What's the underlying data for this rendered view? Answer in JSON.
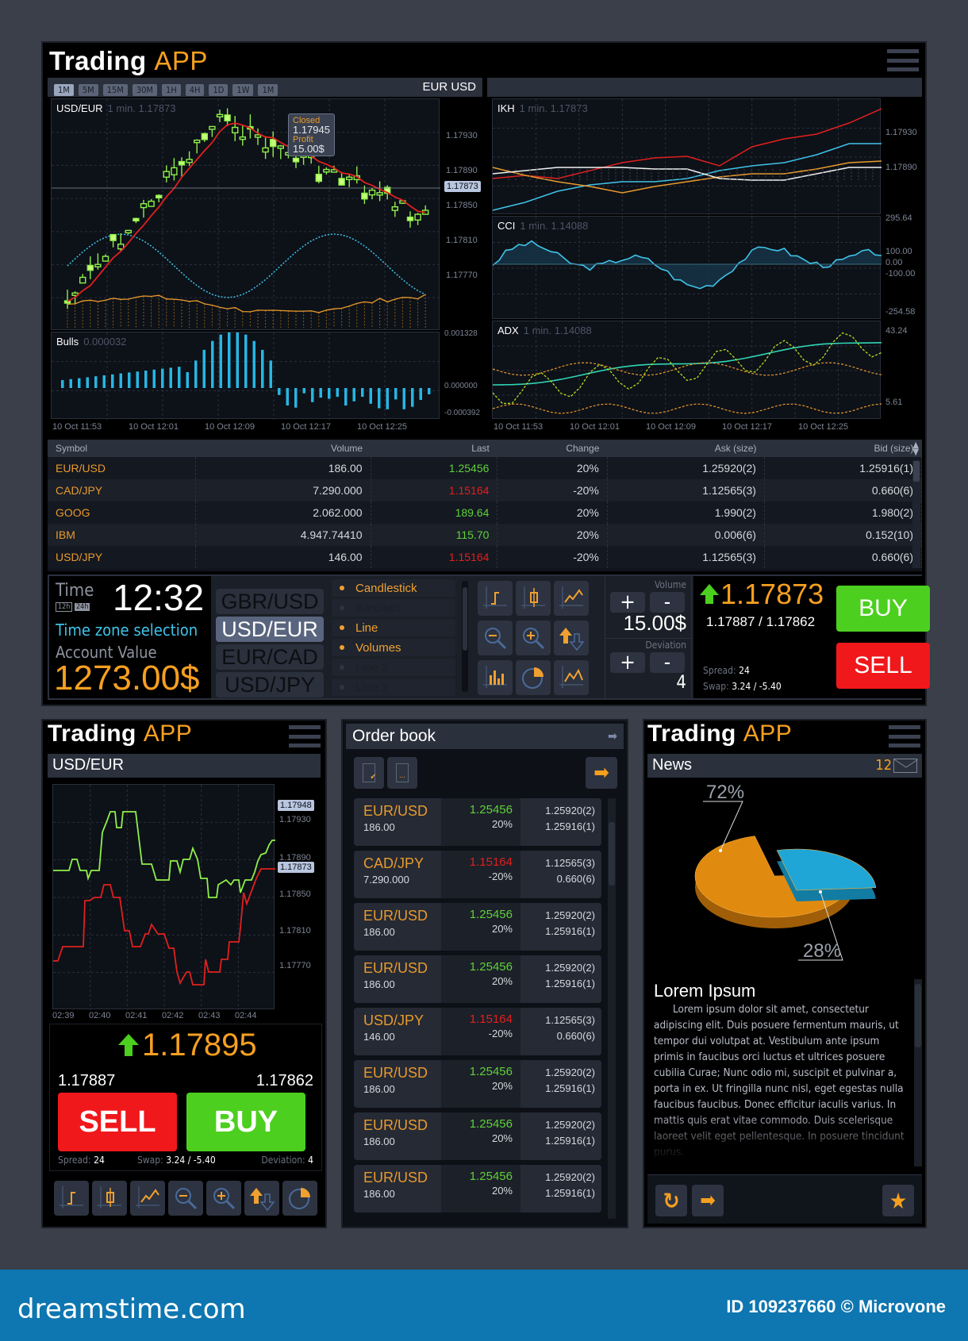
{
  "app": {
    "title_main": "Trading",
    "title_accent": "APP"
  },
  "main_chart": {
    "timeframes": [
      "1M",
      "5M",
      "15M",
      "30M",
      "1H",
      "4H",
      "1D",
      "1W",
      "1M"
    ],
    "active_timeframe_index": 0,
    "pair_label": "EUR USD",
    "symbol": "USD/EUR",
    "symbol_sub": "1 min. 1.17873",
    "tooltip": {
      "closed_label": "Closed",
      "closed_value": "1.17945",
      "profit_label": "Profit",
      "profit_value": "15.00$"
    },
    "y_ticks": [
      "1.17930",
      "1.17890",
      "1.17850",
      "1.17810",
      "1.17770"
    ],
    "current_price_tag": "1.17873",
    "bulls_label": "Bulls",
    "bulls_sub": "0.000032",
    "bulls_ticks": [
      "0.001328",
      "0.000000",
      "-0.000392"
    ],
    "x_ticks": [
      "10 Oct 11:53",
      "10 Oct 12:01",
      "10 Oct 12:09",
      "10 Oct 12:17",
      "10 Oct 12:25"
    ]
  },
  "indicators": {
    "ikh": {
      "label": "IKH",
      "sub": "1 min. 1.17873",
      "ticks": [
        "1.17930",
        "1.17890"
      ]
    },
    "cci": {
      "label": "CCI",
      "sub": "1 min. 1.14088",
      "ticks": [
        "295.64",
        "100.00",
        "0.00",
        "-100.00",
        "-254.58"
      ]
    },
    "adx": {
      "label": "ADX",
      "sub": "1 min. 1.14088",
      "ticks": [
        "43.24",
        "5.61"
      ]
    },
    "x_ticks": [
      "10 Oct 11:53",
      "10 Oct 12:01",
      "10 Oct 12:09",
      "10 Oct 12:17",
      "10 Oct 12:25"
    ]
  },
  "market_table": {
    "headers": [
      "Symbol",
      "Volume",
      "Last",
      "Change",
      "Ask (size)",
      "Bid (size)"
    ],
    "rows": [
      {
        "symbol": "EUR/USD",
        "volume": "186.00",
        "last": "1.25456",
        "dir": "up",
        "change": "20%",
        "ask": "1.25920(2)",
        "bid": "1.25916(1)"
      },
      {
        "symbol": "CAD/JPY",
        "volume": "7.290.000",
        "last": "1.15164",
        "dir": "dn",
        "change": "-20%",
        "ask": "1.12565(3)",
        "bid": "0.660(6)"
      },
      {
        "symbol": "GOOG",
        "volume": "2.062.000",
        "last": "189.64",
        "dir": "up",
        "change": "20%",
        "ask": "1.990(2)",
        "bid": "1.980(2)"
      },
      {
        "symbol": "IBM",
        "volume": "4.947.74410",
        "last": "115.70",
        "dir": "up",
        "change": "20%",
        "ask": "0.006(6)",
        "bid": "0.152(10)"
      },
      {
        "symbol": "USD/JPY",
        "volume": "146.00",
        "last": "1.15164",
        "dir": "dn",
        "change": "-20%",
        "ask": "1.12565(3)",
        "bid": "0.660(6)"
      }
    ]
  },
  "controls": {
    "time_label": "Time",
    "time_value": "12:32",
    "fmt_12": "12h",
    "fmt_24": "24h",
    "tz_link": "Time zone selection",
    "account_label": "Account Value",
    "account_value": "1273.00$",
    "pairs": [
      "GBR/USD",
      "USD/EUR",
      "EUR/CAD",
      "USD/JPY"
    ],
    "active_pair_index": 1,
    "chart_types": [
      {
        "label": "Candlestick",
        "on": true
      },
      {
        "label": "Barchart",
        "on": false
      },
      {
        "label": "Line",
        "on": true
      },
      {
        "label": "Volumes",
        "on": true
      },
      {
        "label": "Line 2",
        "on": false
      },
      {
        "label": "Line 3",
        "on": false
      }
    ],
    "volume_label": "Volume",
    "volume_value": "15.00$",
    "deviation_label": "Deviation",
    "deviation_value": "4",
    "plus": "+",
    "minus": "-",
    "price": "1.17873",
    "bid_ask": "1.17887 / 1.17862",
    "spread_label": "Spread:",
    "spread_value": "24",
    "swap_label": "Swap:",
    "swap_value": "3.24 / -5.40",
    "buy": "BUY",
    "sell": "SELL"
  },
  "mobile_chart": {
    "title_main": "Trading",
    "title_accent": "APP",
    "symbol": "USD/EUR",
    "y_ticks": [
      "1.17930",
      "1.17890",
      "1.17850",
      "1.17810",
      "1.17770"
    ],
    "tag_high": "1.17948",
    "tag_cur": "1.17873",
    "x_ticks": [
      "02:39",
      "02:40",
      "02:41",
      "02:42",
      "02:43",
      "02:44"
    ],
    "price": "1.17895",
    "sell_price": "1.17887",
    "buy_price": "1.17862",
    "sell": "SELL",
    "buy": "BUY",
    "spread_label": "Spread:",
    "spread_value": "24",
    "swap_label": "Swap:",
    "swap_value": "3.24 / -5.40",
    "deviation_label": "Deviation:",
    "deviation_value": "4"
  },
  "order_book": {
    "title": "Order book",
    "rows": [
      {
        "symbol": "EUR/USD",
        "volume": "186.00",
        "last": "1.25456",
        "dir": "up",
        "change": "20%",
        "ask": "1.25920(2)",
        "bid": "1.25916(1)"
      },
      {
        "symbol": "CAD/JPY",
        "volume": "7.290.000",
        "last": "1.15164",
        "dir": "dn",
        "change": "-20%",
        "ask": "1.12565(3)",
        "bid": "0.660(6)"
      },
      {
        "symbol": "EUR/USD",
        "volume": "186.00",
        "last": "1.25456",
        "dir": "up",
        "change": "20%",
        "ask": "1.25920(2)",
        "bid": "1.25916(1)"
      },
      {
        "symbol": "EUR/USD",
        "volume": "186.00",
        "last": "1.25456",
        "dir": "up",
        "change": "20%",
        "ask": "1.25920(2)",
        "bid": "1.25916(1)"
      },
      {
        "symbol": "USD/JPY",
        "volume": "146.00",
        "last": "1.15164",
        "dir": "dn",
        "change": "-20%",
        "ask": "1.12565(3)",
        "bid": "0.660(6)"
      },
      {
        "symbol": "EUR/USD",
        "volume": "186.00",
        "last": "1.25456",
        "dir": "up",
        "change": "20%",
        "ask": "1.25920(2)",
        "bid": "1.25916(1)"
      },
      {
        "symbol": "EUR/USD",
        "volume": "186.00",
        "last": "1.25456",
        "dir": "up",
        "change": "20%",
        "ask": "1.25920(2)",
        "bid": "1.25916(1)"
      },
      {
        "symbol": "EUR/USD",
        "volume": "186.00",
        "last": "1.25456",
        "dir": "up",
        "change": "20%",
        "ask": "1.25920(2)",
        "bid": "1.25916(1)"
      }
    ]
  },
  "news": {
    "title_main": "Trading",
    "title_accent": "APP",
    "label": "News",
    "count": "12",
    "pie": {
      "slices": [
        {
          "label": "72%",
          "value": 72,
          "color": "#e08a10"
        },
        {
          "label": "28%",
          "value": 28,
          "color": "#1fa6d6"
        }
      ]
    },
    "headline": "Lorem Ipsum",
    "body": "Lorem ipsum dolor sit amet, consectetur adipiscing elit. Duis posuere fermentum mauris, ut tempor dui volutpat at. Vestibulum ante ipsum primis in faucibus orci luctus et ultrices posuere cubilia Curae; Nunc odio mi, suscipit et pulvinar a, porta in ex. Ut fringilla nunc nisl, eget egestas nulla faucibus faucibus. Donec efficitur iaculis varius. In mattis quis erat vitae commodo. Duis scelerisque laoreet velit eget pellentesque. In posuere tincidunt purus."
  },
  "footer": {
    "brand": "dreamstime.com",
    "credit": "ID 109237660 © Microvone"
  }
}
